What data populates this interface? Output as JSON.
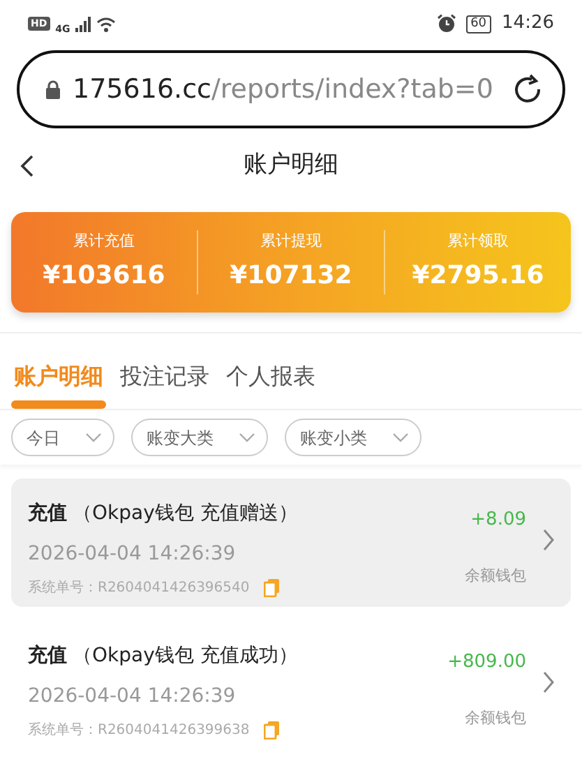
{
  "status_bar": {
    "hd": "HD",
    "network": "4G",
    "battery": "60",
    "time": "14:26"
  },
  "address_bar": {
    "domain": "175616.cc",
    "path": "/reports/index?tab=0"
  },
  "header": {
    "title": "账户明细"
  },
  "summary": [
    {
      "label": "累计充值",
      "value": "¥103616"
    },
    {
      "label": "累计提现",
      "value": "¥107132"
    },
    {
      "label": "累计领取",
      "value": "¥2795.16"
    }
  ],
  "tabs": [
    {
      "label": "账户明细",
      "selected": true
    },
    {
      "label": "投注记录",
      "selected": false
    },
    {
      "label": "个人报表",
      "selected": false
    }
  ],
  "filters": [
    {
      "label": "今日"
    },
    {
      "label": "账变大类"
    },
    {
      "label": "账变小类"
    }
  ],
  "entries": [
    {
      "type": "充值",
      "detail": "（Okpay钱包 充值赠送）",
      "time": "2026-04-04 14:26:39",
      "serial_label": "系统单号：",
      "serial": "R2604041426396540",
      "amount": "+8.09",
      "wallet": "余额钱包",
      "selected": true
    },
    {
      "type": "充值",
      "detail": "（Okpay钱包 充值成功）",
      "time": "2026-04-04 14:26:39",
      "serial_label": "系统单号：",
      "serial": "R2604041426399638",
      "amount": "+809.00",
      "wallet": "余额钱包",
      "selected": false
    }
  ]
}
